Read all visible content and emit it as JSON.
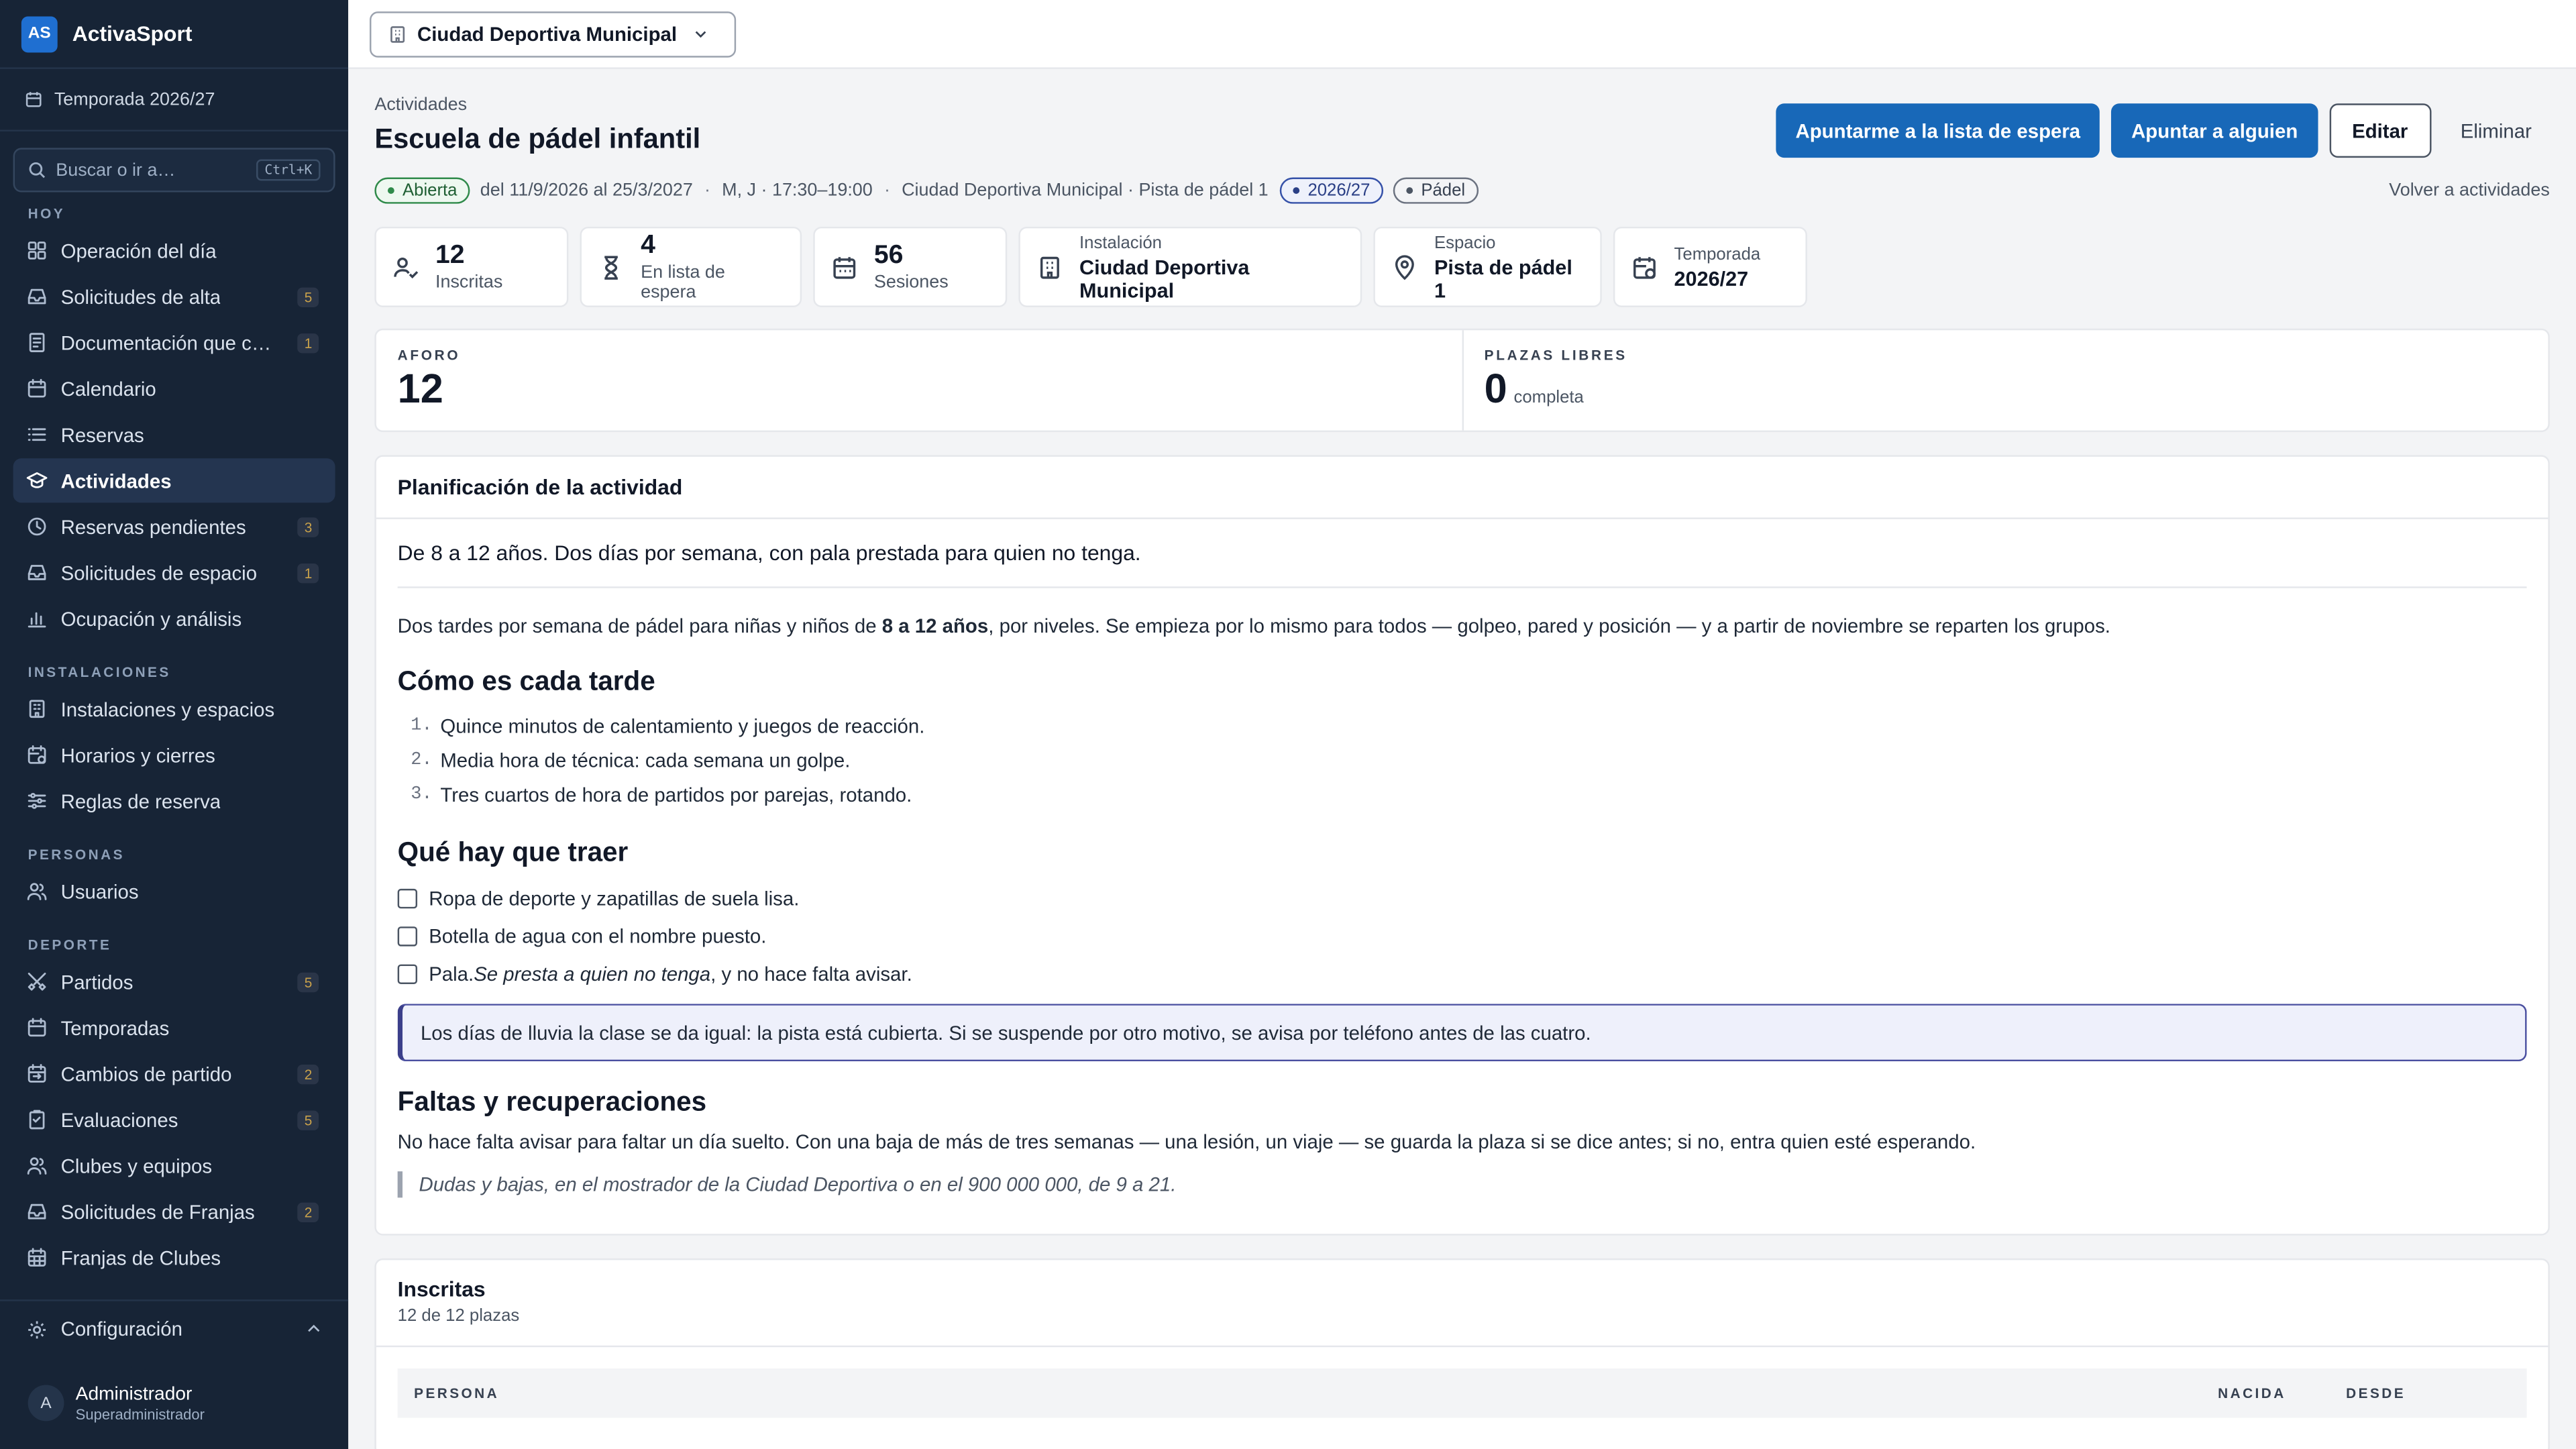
{
  "brand": {
    "initials": "AS",
    "name": "ActivaSport"
  },
  "season_selector": "Temporada 2026/27",
  "search": {
    "placeholder": "Buscar o ir a…",
    "shortcut": "Ctrl+K"
  },
  "sidebar": {
    "sections": [
      {
        "label": "HOY",
        "items": [
          {
            "label": "Operación del día",
            "icon": "grid-icon"
          },
          {
            "label": "Solicitudes de alta",
            "icon": "inbox-icon",
            "badge": "5"
          },
          {
            "label": "Documentación que ca…",
            "icon": "document-icon",
            "badge": "1"
          },
          {
            "label": "Calendario",
            "icon": "calendar-icon"
          },
          {
            "label": "Reservas",
            "icon": "list-icon"
          },
          {
            "label": "Actividades",
            "icon": "graduation-cap-icon",
            "active": true
          },
          {
            "label": "Reservas pendientes",
            "icon": "clock-icon",
            "badge": "3"
          },
          {
            "label": "Solicitudes de espacio",
            "icon": "inbox-icon",
            "badge": "1"
          },
          {
            "label": "Ocupación y análisis",
            "icon": "bar-chart-icon"
          }
        ]
      },
      {
        "label": "INSTALACIONES",
        "items": [
          {
            "label": "Instalaciones y espacios",
            "icon": "building-icon"
          },
          {
            "label": "Horarios y cierres",
            "icon": "calendar-clock-icon"
          },
          {
            "label": "Reglas de reserva",
            "icon": "sliders-icon"
          }
        ]
      },
      {
        "label": "PERSONAS",
        "items": [
          {
            "label": "Usuarios",
            "icon": "users-icon"
          }
        ]
      },
      {
        "label": "DEPORTE",
        "items": [
          {
            "label": "Partidos",
            "icon": "swords-icon",
            "badge": "5"
          },
          {
            "label": "Temporadas",
            "icon": "calendar-icon"
          },
          {
            "label": "Cambios de partido",
            "icon": "calendar-swap-icon",
            "badge": "2"
          },
          {
            "label": "Evaluaciones",
            "icon": "clipboard-icon",
            "badge": "5"
          },
          {
            "label": "Clubes y equipos",
            "icon": "users-icon"
          },
          {
            "label": "Solicitudes de Franjas",
            "icon": "inbox-icon",
            "badge": "2"
          },
          {
            "label": "Franjas de Clubes",
            "icon": "calendar-grid-icon"
          }
        ]
      }
    ]
  },
  "config_label": "Configuración",
  "user": {
    "initial": "A",
    "name": "Administrador",
    "role": "Superadministrador"
  },
  "topbar": {
    "facility": "Ciudad Deportiva Municipal"
  },
  "breadcrumb": "Actividades",
  "page_title": "Escuela de pádel infantil",
  "actions": {
    "waitlist": "Apuntarme a la lista de espera",
    "enroll": "Apuntar a alguien",
    "edit": "Editar",
    "delete": "Eliminar"
  },
  "meta": {
    "status": "Abierta",
    "dates": "del 11/9/2026 al 25/3/2027",
    "schedule": "M, J · 17:30–19:00",
    "location": "Ciudad Deportiva Municipal · Pista de pádel 1",
    "season_tag": "2026/27",
    "sport_tag": "Pádel",
    "back": "Volver a actividades"
  },
  "stats": [
    {
      "num": "12",
      "label": "Inscritas",
      "icon": "user-check-icon"
    },
    {
      "num": "4",
      "label": "En lista de espera",
      "icon": "hourglass-icon"
    },
    {
      "num": "56",
      "label": "Sesiones",
      "icon": "calendar-icon"
    }
  ],
  "info": [
    {
      "label": "Instalación",
      "value": "Ciudad Deportiva Municipal",
      "icon": "building-icon"
    },
    {
      "label": "Espacio",
      "value": "Pista de pádel 1",
      "icon": "pin-icon"
    },
    {
      "label": "Temporada",
      "value": "2026/27",
      "icon": "calendar-clock-icon"
    }
  ],
  "capacity": {
    "aforo_label": "AFORO",
    "aforo": "12",
    "free_label": "PLAZAS LIBRES",
    "free": "0",
    "free_sub": "completa"
  },
  "plan": {
    "title": "Planificación de la actividad",
    "summary": "De 8 a 12 años. Dos días por semana, con pala prestada para quien no tenga.",
    "intro_a": "Dos tardes por semana de pádel para niñas y niños de ",
    "intro_bold": "8 a 12 años",
    "intro_b": ", por niveles. Se empieza por lo mismo para todos  — golpeo, pared y posición —  y a partir de noviembre se reparten los grupos.",
    "h_afternoon": "Cómo es cada tarde",
    "steps": [
      "Quince minutos de calentamiento y juegos de reacción.",
      "Media hora de técnica: cada semana un golpe.",
      "Tres cuartos de hora de partidos por parejas, rotando."
    ],
    "h_bring": "Qué hay que traer",
    "bring_1": "Ropa de deporte y zapatillas de suela lisa.",
    "bring_2": "Botella de agua con el nombre puesto.",
    "bring_3a": "Pala. ",
    "bring_3i": "Se presta a quien no tenga",
    "bring_3b": ", y no hace falta avisar.",
    "callout": "Los días de lluvia la clase se da igual: la pista está cubierta. Si se suspende por otro motivo, se avisa por teléfono antes de las cuatro.",
    "h_absences": "Faltas y recuperaciones",
    "absences": "No hace falta avisar para faltar un día suelto. Con una baja de más de tres semanas  — una lesión, un viaje —  se guarda la plaza si se dice antes; si no, entra quien esté esperando.",
    "quote": "Dudas y bajas, en el mostrador de la Ciudad Deportiva o en el 900 000 000, de 9 a 21."
  },
  "enrolled": {
    "title": "Inscritas",
    "subtitle": "12 de 12 plazas",
    "columns": [
      "PERSONA",
      "NACIDA",
      "DESDE"
    ]
  }
}
